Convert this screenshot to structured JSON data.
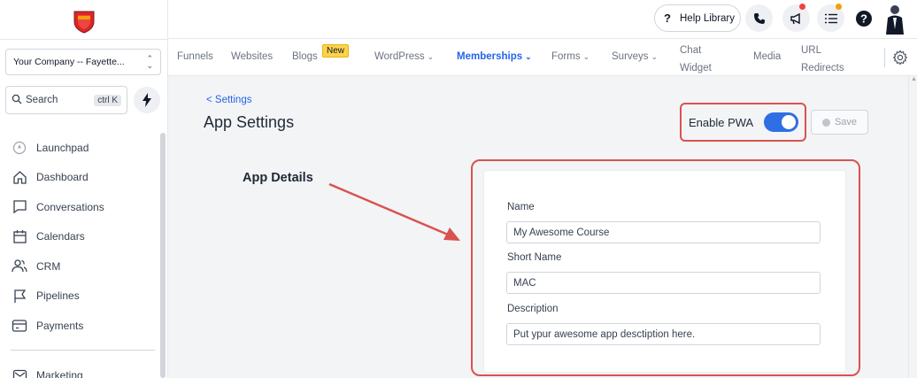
{
  "sidebar": {
    "company": "Your Company -- Fayette...",
    "search_label": "Search",
    "search_shortcut": "ctrl K",
    "items": [
      {
        "label": "Launchpad",
        "icon": "launchpad-icon"
      },
      {
        "label": "Dashboard",
        "icon": "home-icon"
      },
      {
        "label": "Conversations",
        "icon": "chat-icon"
      },
      {
        "label": "Calendars",
        "icon": "calendar-icon"
      },
      {
        "label": "CRM",
        "icon": "users-icon"
      },
      {
        "label": "Pipelines",
        "icon": "flag-icon"
      },
      {
        "label": "Payments",
        "icon": "card-icon"
      }
    ],
    "marketing": "Marketing"
  },
  "topbar": {
    "help_library": "Help Library",
    "help_glyph": "?"
  },
  "subnav": {
    "funnels": "Funnels",
    "websites": "Websites",
    "blogs": "Blogs",
    "new_badge": "New",
    "wordpress": "WordPress",
    "memberships": "Memberships",
    "forms": "Forms",
    "surveys": "Surveys",
    "chat_widget_1": "Chat",
    "chat_widget_2": "Widget",
    "media": "Media",
    "url_redirects_1": "URL",
    "url_redirects_2": "Redirects"
  },
  "page": {
    "back_link": "< Settings",
    "title": "App Settings",
    "enable_pwa": "Enable PWA",
    "pwa_enabled": true,
    "save": "Save",
    "section_title": "App Details"
  },
  "form": {
    "name_label": "Name",
    "name_value": "My Awesome Course",
    "short_name_label": "Short Name",
    "short_name_value": "MAC",
    "description_label": "Description",
    "description_value": "Put ypur awesome app desctiption here."
  },
  "colors": {
    "accent": "#2563eb",
    "toggle": "#2f6fe3",
    "annotation": "#d9534f"
  }
}
